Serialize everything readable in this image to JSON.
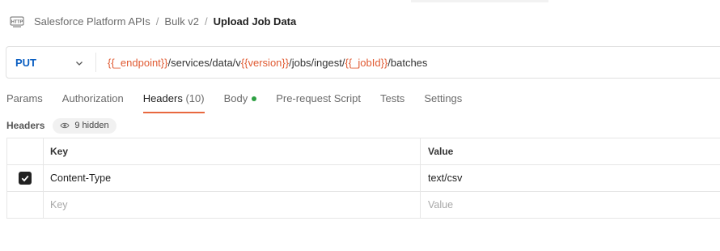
{
  "breadcrumb": {
    "items": [
      "Salesforce Platform APIs",
      "Bulk v2"
    ],
    "separator": "/",
    "current": "Upload Job Data"
  },
  "request": {
    "method": "PUT",
    "method_color": "#0b5fc2",
    "url_parts": [
      {
        "text": "{{_endpoint}}",
        "var": true
      },
      {
        "text": "/services/data/v",
        "var": false
      },
      {
        "text": "{{version}}",
        "var": true
      },
      {
        "text": "/jobs/ingest/",
        "var": false
      },
      {
        "text": "{{_jobId}}",
        "var": true
      },
      {
        "text": "/batches",
        "var": false
      }
    ],
    "variable_color": "#e05a32"
  },
  "tabs": [
    {
      "label": "Params",
      "active": false
    },
    {
      "label": "Authorization",
      "active": false
    },
    {
      "label": "Headers",
      "count": "(10)",
      "active": true
    },
    {
      "label": "Body",
      "has_dot": true,
      "active": false
    },
    {
      "label": "Pre-request Script",
      "active": false
    },
    {
      "label": "Tests",
      "active": false
    },
    {
      "label": "Settings",
      "active": false
    }
  ],
  "headers_section": {
    "label": "Headers",
    "hidden_label": "9 hidden"
  },
  "table": {
    "columns": {
      "key": "Key",
      "value": "Value"
    },
    "rows": [
      {
        "checked": true,
        "key": "Content-Type",
        "value": "text/csv"
      }
    ],
    "new_row": {
      "key_placeholder": "Key",
      "value_placeholder": "Value"
    }
  },
  "colors": {
    "active_tab_underline": "#e8683f",
    "body_dot": "#2ea043"
  }
}
